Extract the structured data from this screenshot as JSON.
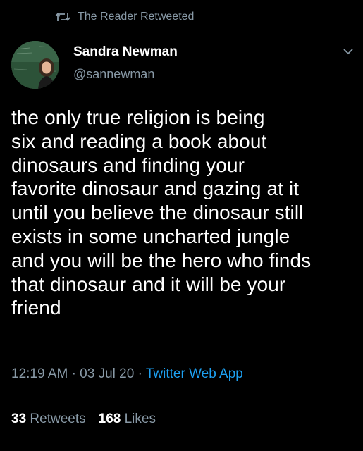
{
  "retweet_header": {
    "icon": "retweet-icon",
    "text": "The Reader Retweeted"
  },
  "author": {
    "name": "Sandra Newman",
    "handle": "@sannewman",
    "avatar_icon": "avatar"
  },
  "menu": {
    "icon": "chevron-down-icon"
  },
  "tweet": {
    "lines": [
      "the only true religion is being",
      "six and reading a book about",
      "dinosaurs and finding your",
      "favorite dinosaur and gazing at it",
      "until you believe the dinosaur still",
      "exists in some uncharted jungle",
      "and you will be the hero who finds",
      "that dinosaur and it will be your",
      "friend"
    ]
  },
  "meta": {
    "time": "12:19 AM",
    "separator": "·",
    "date": "03 Jul 20",
    "source": "Twitter Web App"
  },
  "stats": {
    "retweets_count": "33",
    "retweets_label": "Retweets",
    "likes_count": "168",
    "likes_label": "Likes"
  },
  "colors": {
    "background": "#000000",
    "text": "#ffffff",
    "muted": "#8899a6",
    "link": "#1da1f2"
  }
}
